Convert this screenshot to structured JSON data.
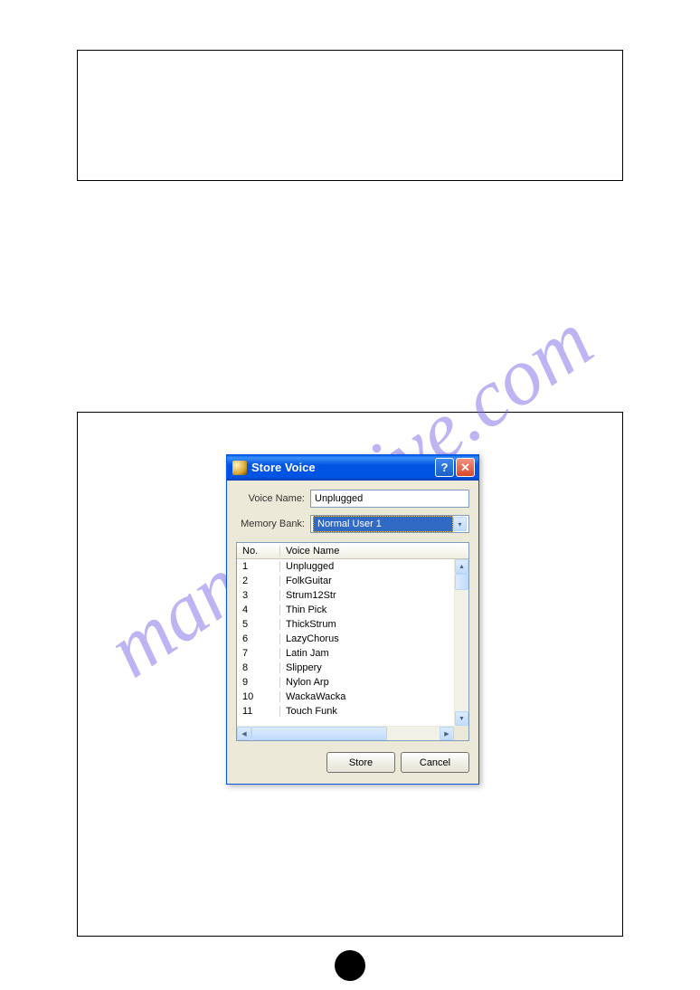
{
  "watermark": "manualshive.com",
  "dialog": {
    "title": "Store Voice",
    "voiceLabel": "Voice Name:",
    "voiceValue": "Unplugged",
    "bankLabel": "Memory Bank:",
    "bankValue": "Normal User 1",
    "header": {
      "no": "No.",
      "name": "Voice Name"
    },
    "rows": [
      {
        "no": "1",
        "name": "Unplugged"
      },
      {
        "no": "2",
        "name": "FolkGuitar"
      },
      {
        "no": "3",
        "name": "Strum12Str"
      },
      {
        "no": "4",
        "name": "Thin Pick"
      },
      {
        "no": "5",
        "name": "ThickStrum"
      },
      {
        "no": "6",
        "name": "LazyChorus"
      },
      {
        "no": "7",
        "name": "Latin Jam"
      },
      {
        "no": "8",
        "name": "Slippery"
      },
      {
        "no": "9",
        "name": "Nylon Arp"
      },
      {
        "no": "10",
        "name": "WackaWacka"
      },
      {
        "no": "11",
        "name": "Touch Funk"
      }
    ],
    "storeLabel": "Store",
    "cancelLabel": "Cancel"
  }
}
